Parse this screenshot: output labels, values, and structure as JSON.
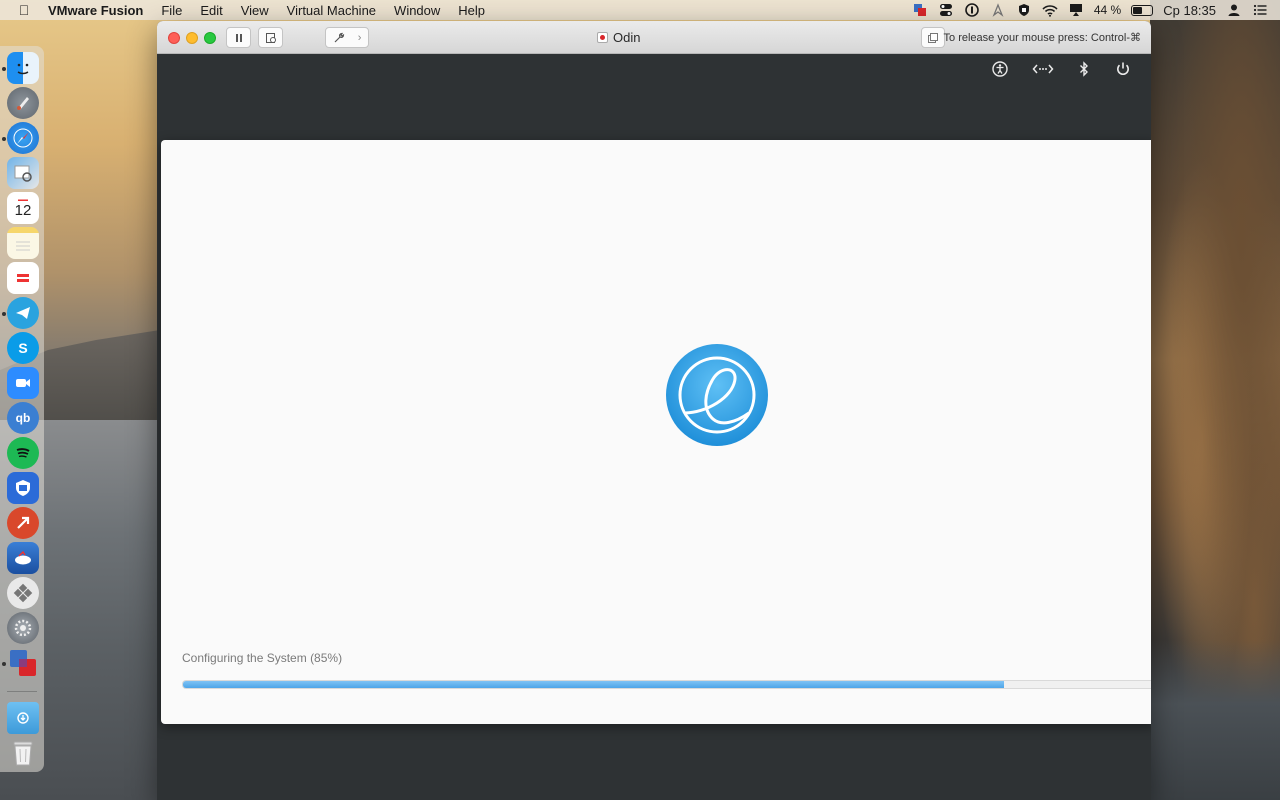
{
  "menubar": {
    "apple_icon": "apple-icon",
    "app_name": "VMware Fusion",
    "items": [
      "File",
      "Edit",
      "View",
      "Virtual Machine",
      "Window",
      "Help"
    ],
    "battery_percent": "44 %",
    "clock": "Ср 18:35",
    "status_icons": [
      "vmware-icon",
      "control-center-icon",
      "onepassword-icon",
      "location-icon",
      "shield-icon",
      "wifi-icon",
      "airplay-icon",
      "battery-icon",
      "user-icon",
      "list-icon"
    ]
  },
  "dock": {
    "calendar_day": "12",
    "apps": [
      "finder-icon",
      "launchpad-icon",
      "safari-icon",
      "preview-icon",
      "calendar-icon",
      "notes-icon",
      "app-icon",
      "telegram-icon",
      "skype-icon",
      "zoom-icon",
      "qbittorrent-icon",
      "spotify-icon",
      "adguard-icon",
      "remote-desktop-icon",
      "cloud-icon",
      "settings-icon",
      "system-preferences-icon",
      "vmware-icon",
      "downloads-folder-icon",
      "trash-icon"
    ]
  },
  "window": {
    "title": "Odin",
    "release_hint": "To release your mouse press: Control-⌘"
  },
  "guest": {
    "panel_icons": [
      "accessibility-icon",
      "network-icon",
      "bluetooth-icon",
      "power-icon"
    ],
    "progress_label": "Configuring the System (85%)",
    "progress_fraction": 0.845
  },
  "colors": {
    "accent": "#4ea5e8",
    "guest_background": "#2e3234",
    "installer_background": "#fafafa"
  }
}
